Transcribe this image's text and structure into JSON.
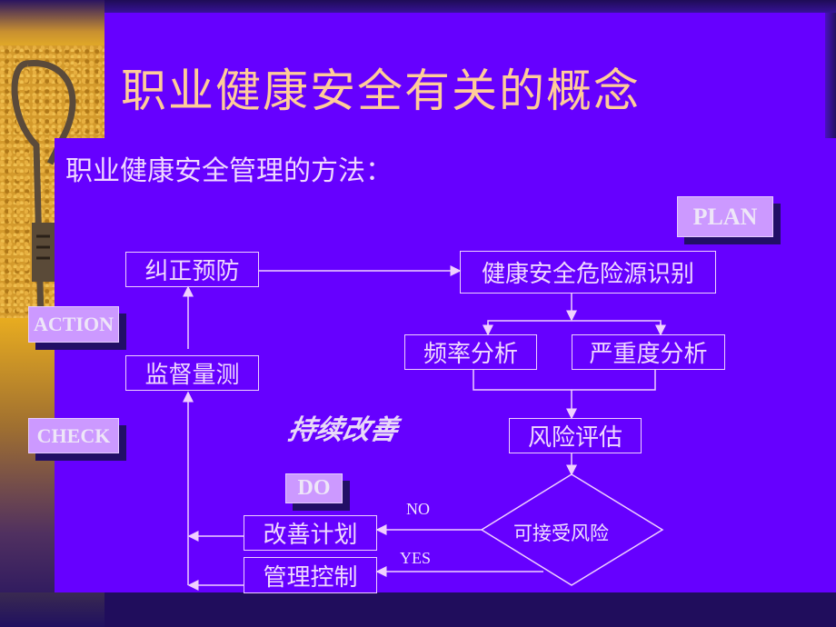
{
  "slide": {
    "title": "职业健康安全有关的概念",
    "subtitle": "职业健康安全管理的方法：",
    "theme_colors": {
      "panel": "#6600FF",
      "title_text": "#FFCC99",
      "tag_fill": "#CC99FF",
      "dark": "#200D5C"
    }
  },
  "tags": {
    "plan": "PLAN",
    "action": "ACTION",
    "check": "CHECK",
    "do": "DO"
  },
  "flowchart": {
    "corrective": "纠正预防",
    "hazard_identification": "健康安全危险源识别",
    "frequency_analysis": "频率分析",
    "severity_analysis": "严重度分析",
    "risk_assessment": "风险评估",
    "acceptable_risk": "可接受风险",
    "improvement_plan": "改善计划",
    "management_control": "管理控制",
    "monitoring": "监督量测",
    "no_label": "NO",
    "yes_label": "YES",
    "continuous_improvement": "持续改善"
  }
}
